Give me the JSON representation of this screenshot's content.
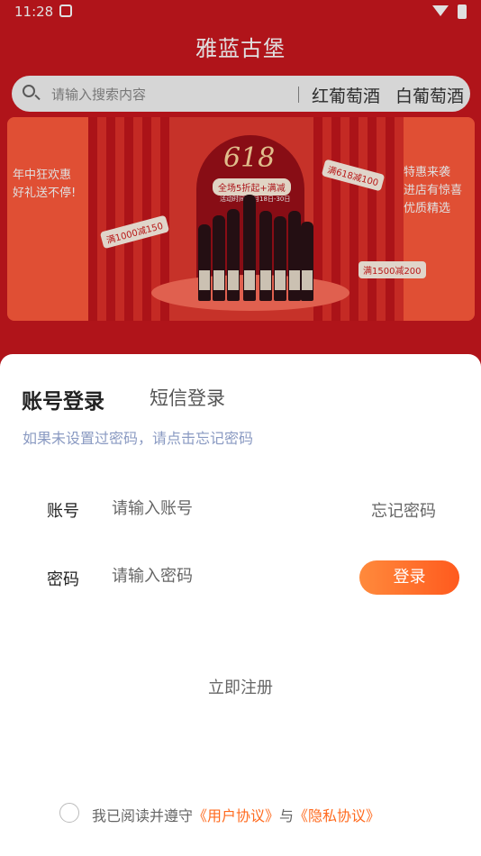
{
  "status": {
    "time": "11:28"
  },
  "app": {
    "title": "雅蓝古堡"
  },
  "search": {
    "placeholder": "请输入搜索内容",
    "tags": [
      "红葡萄酒",
      "白葡萄酒"
    ]
  },
  "banner": {
    "title": "618",
    "subtitle": "全场5折起+满减",
    "date": "活动时间: 6月18日-30日",
    "left_text": [
      "年中狂欢惠",
      "好礼送不停!"
    ],
    "right_text": [
      "特惠来袭",
      "进店有惊喜",
      "优质精选"
    ],
    "coupons": [
      "满1000减150",
      "满618减100",
      "满1500减200"
    ]
  },
  "login": {
    "tabs": {
      "account": "账号登录",
      "sms": "短信登录"
    },
    "hint": "如果未设置过密码，请点击忘记密码",
    "account_label": "账号",
    "account_placeholder": "请输入账号",
    "forgot": "忘记密码",
    "password_label": "密码",
    "password_placeholder": "请输入密码",
    "login_button": "登录",
    "register": "立即注册",
    "agreement": {
      "prefix": "我已阅读并遵守",
      "user": "《用户协议》",
      "and": "与",
      "privacy": "《隐私协议》"
    }
  },
  "colors": {
    "brand_red": "#c9171e",
    "accent_orange": "#ff6a1e",
    "hint_blue": "#8a9ac2"
  }
}
